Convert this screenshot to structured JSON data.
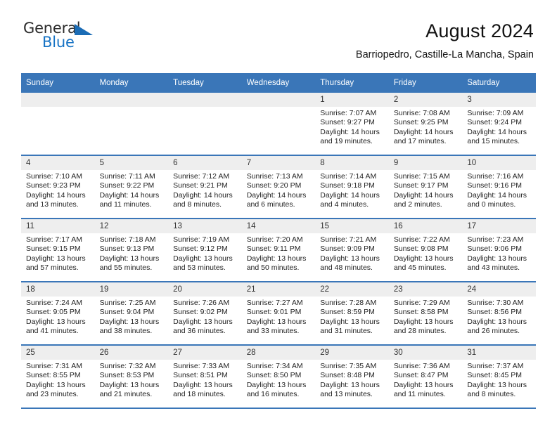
{
  "brand": {
    "logo_line1": "General",
    "logo_line2": "Blue",
    "accent_color": "#1b6cb5"
  },
  "header": {
    "title": "August 2024",
    "subtitle": "Barriopedro, Castille-La Mancha, Spain"
  },
  "theme": {
    "header_row_bg": "#3a76b8",
    "daynum_bg": "#eeeeee",
    "grid_line": "#3a76b8"
  },
  "weekday_headers": [
    "Sunday",
    "Monday",
    "Tuesday",
    "Wednesday",
    "Thursday",
    "Friday",
    "Saturday"
  ],
  "weeks": [
    [
      {
        "day": "",
        "blank": true
      },
      {
        "day": "",
        "blank": true
      },
      {
        "day": "",
        "blank": true
      },
      {
        "day": "",
        "blank": true
      },
      {
        "day": "1",
        "sunrise": "Sunrise: 7:07 AM",
        "sunset": "Sunset: 9:27 PM",
        "daylight1": "Daylight: 14 hours",
        "daylight2": "and 19 minutes."
      },
      {
        "day": "2",
        "sunrise": "Sunrise: 7:08 AM",
        "sunset": "Sunset: 9:25 PM",
        "daylight1": "Daylight: 14 hours",
        "daylight2": "and 17 minutes."
      },
      {
        "day": "3",
        "sunrise": "Sunrise: 7:09 AM",
        "sunset": "Sunset: 9:24 PM",
        "daylight1": "Daylight: 14 hours",
        "daylight2": "and 15 minutes."
      }
    ],
    [
      {
        "day": "4",
        "sunrise": "Sunrise: 7:10 AM",
        "sunset": "Sunset: 9:23 PM",
        "daylight1": "Daylight: 14 hours",
        "daylight2": "and 13 minutes."
      },
      {
        "day": "5",
        "sunrise": "Sunrise: 7:11 AM",
        "sunset": "Sunset: 9:22 PM",
        "daylight1": "Daylight: 14 hours",
        "daylight2": "and 11 minutes."
      },
      {
        "day": "6",
        "sunrise": "Sunrise: 7:12 AM",
        "sunset": "Sunset: 9:21 PM",
        "daylight1": "Daylight: 14 hours",
        "daylight2": "and 8 minutes."
      },
      {
        "day": "7",
        "sunrise": "Sunrise: 7:13 AM",
        "sunset": "Sunset: 9:20 PM",
        "daylight1": "Daylight: 14 hours",
        "daylight2": "and 6 minutes."
      },
      {
        "day": "8",
        "sunrise": "Sunrise: 7:14 AM",
        "sunset": "Sunset: 9:18 PM",
        "daylight1": "Daylight: 14 hours",
        "daylight2": "and 4 minutes."
      },
      {
        "day": "9",
        "sunrise": "Sunrise: 7:15 AM",
        "sunset": "Sunset: 9:17 PM",
        "daylight1": "Daylight: 14 hours",
        "daylight2": "and 2 minutes."
      },
      {
        "day": "10",
        "sunrise": "Sunrise: 7:16 AM",
        "sunset": "Sunset: 9:16 PM",
        "daylight1": "Daylight: 14 hours",
        "daylight2": "and 0 minutes."
      }
    ],
    [
      {
        "day": "11",
        "sunrise": "Sunrise: 7:17 AM",
        "sunset": "Sunset: 9:15 PM",
        "daylight1": "Daylight: 13 hours",
        "daylight2": "and 57 minutes."
      },
      {
        "day": "12",
        "sunrise": "Sunrise: 7:18 AM",
        "sunset": "Sunset: 9:13 PM",
        "daylight1": "Daylight: 13 hours",
        "daylight2": "and 55 minutes."
      },
      {
        "day": "13",
        "sunrise": "Sunrise: 7:19 AM",
        "sunset": "Sunset: 9:12 PM",
        "daylight1": "Daylight: 13 hours",
        "daylight2": "and 53 minutes."
      },
      {
        "day": "14",
        "sunrise": "Sunrise: 7:20 AM",
        "sunset": "Sunset: 9:11 PM",
        "daylight1": "Daylight: 13 hours",
        "daylight2": "and 50 minutes."
      },
      {
        "day": "15",
        "sunrise": "Sunrise: 7:21 AM",
        "sunset": "Sunset: 9:09 PM",
        "daylight1": "Daylight: 13 hours",
        "daylight2": "and 48 minutes."
      },
      {
        "day": "16",
        "sunrise": "Sunrise: 7:22 AM",
        "sunset": "Sunset: 9:08 PM",
        "daylight1": "Daylight: 13 hours",
        "daylight2": "and 45 minutes."
      },
      {
        "day": "17",
        "sunrise": "Sunrise: 7:23 AM",
        "sunset": "Sunset: 9:06 PM",
        "daylight1": "Daylight: 13 hours",
        "daylight2": "and 43 minutes."
      }
    ],
    [
      {
        "day": "18",
        "sunrise": "Sunrise: 7:24 AM",
        "sunset": "Sunset: 9:05 PM",
        "daylight1": "Daylight: 13 hours",
        "daylight2": "and 41 minutes."
      },
      {
        "day": "19",
        "sunrise": "Sunrise: 7:25 AM",
        "sunset": "Sunset: 9:04 PM",
        "daylight1": "Daylight: 13 hours",
        "daylight2": "and 38 minutes."
      },
      {
        "day": "20",
        "sunrise": "Sunrise: 7:26 AM",
        "sunset": "Sunset: 9:02 PM",
        "daylight1": "Daylight: 13 hours",
        "daylight2": "and 36 minutes."
      },
      {
        "day": "21",
        "sunrise": "Sunrise: 7:27 AM",
        "sunset": "Sunset: 9:01 PM",
        "daylight1": "Daylight: 13 hours",
        "daylight2": "and 33 minutes."
      },
      {
        "day": "22",
        "sunrise": "Sunrise: 7:28 AM",
        "sunset": "Sunset: 8:59 PM",
        "daylight1": "Daylight: 13 hours",
        "daylight2": "and 31 minutes."
      },
      {
        "day": "23",
        "sunrise": "Sunrise: 7:29 AM",
        "sunset": "Sunset: 8:58 PM",
        "daylight1": "Daylight: 13 hours",
        "daylight2": "and 28 minutes."
      },
      {
        "day": "24",
        "sunrise": "Sunrise: 7:30 AM",
        "sunset": "Sunset: 8:56 PM",
        "daylight1": "Daylight: 13 hours",
        "daylight2": "and 26 minutes."
      }
    ],
    [
      {
        "day": "25",
        "sunrise": "Sunrise: 7:31 AM",
        "sunset": "Sunset: 8:55 PM",
        "daylight1": "Daylight: 13 hours",
        "daylight2": "and 23 minutes."
      },
      {
        "day": "26",
        "sunrise": "Sunrise: 7:32 AM",
        "sunset": "Sunset: 8:53 PM",
        "daylight1": "Daylight: 13 hours",
        "daylight2": "and 21 minutes."
      },
      {
        "day": "27",
        "sunrise": "Sunrise: 7:33 AM",
        "sunset": "Sunset: 8:51 PM",
        "daylight1": "Daylight: 13 hours",
        "daylight2": "and 18 minutes."
      },
      {
        "day": "28",
        "sunrise": "Sunrise: 7:34 AM",
        "sunset": "Sunset: 8:50 PM",
        "daylight1": "Daylight: 13 hours",
        "daylight2": "and 16 minutes."
      },
      {
        "day": "29",
        "sunrise": "Sunrise: 7:35 AM",
        "sunset": "Sunset: 8:48 PM",
        "daylight1": "Daylight: 13 hours",
        "daylight2": "and 13 minutes."
      },
      {
        "day": "30",
        "sunrise": "Sunrise: 7:36 AM",
        "sunset": "Sunset: 8:47 PM",
        "daylight1": "Daylight: 13 hours",
        "daylight2": "and 11 minutes."
      },
      {
        "day": "31",
        "sunrise": "Sunrise: 7:37 AM",
        "sunset": "Sunset: 8:45 PM",
        "daylight1": "Daylight: 13 hours",
        "daylight2": "and 8 minutes."
      }
    ]
  ]
}
